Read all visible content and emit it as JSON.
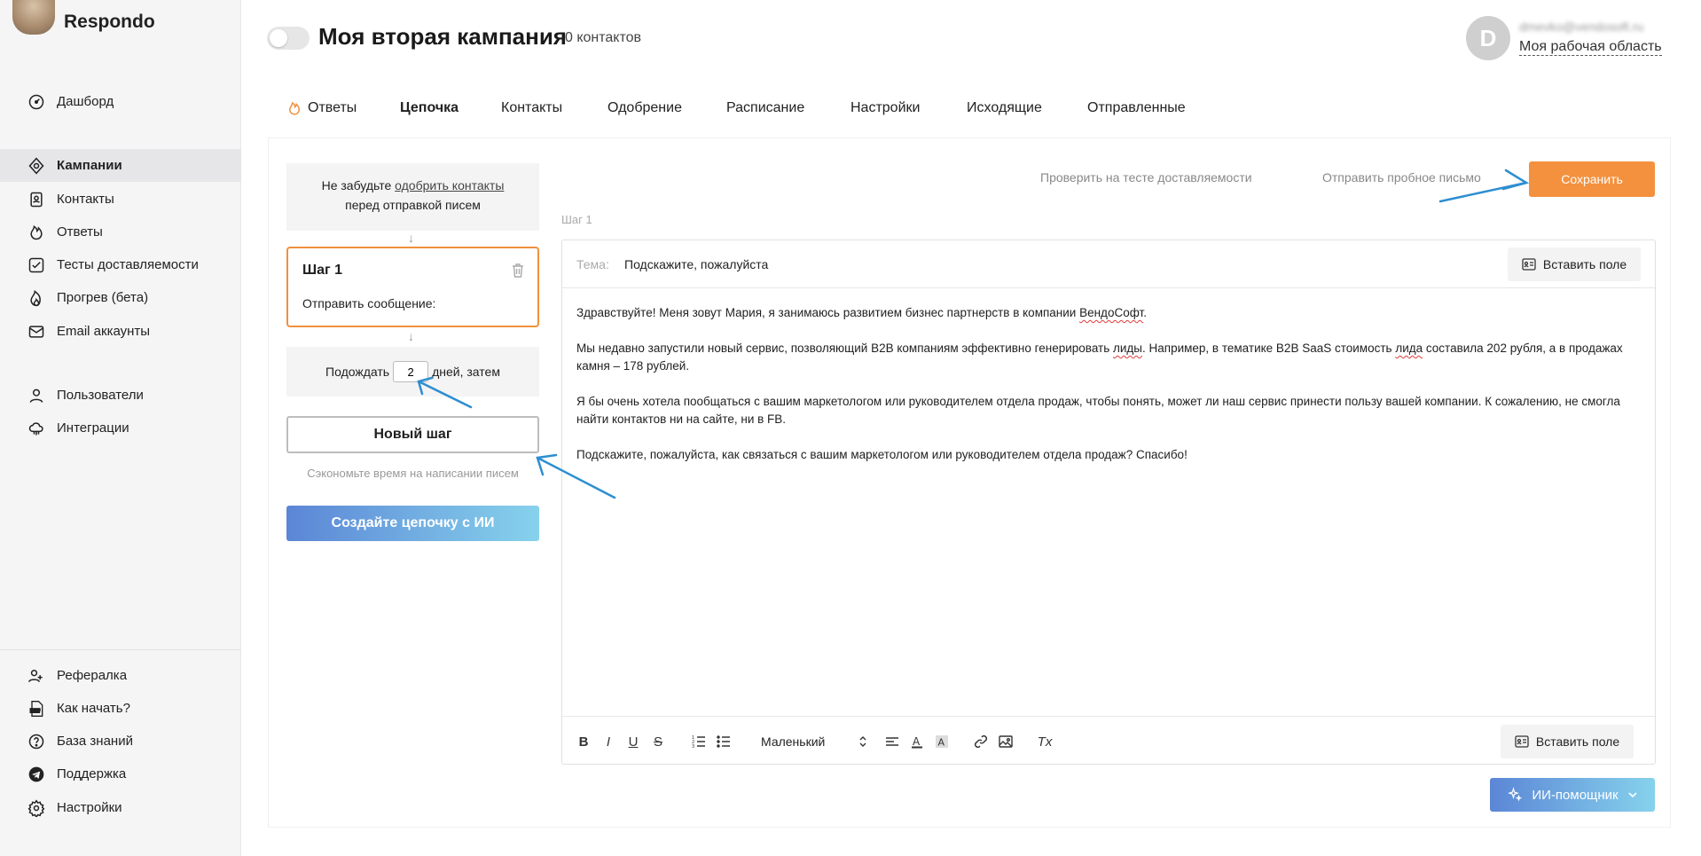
{
  "app": {
    "name": "Respondo"
  },
  "sidebar": {
    "items_top": [
      {
        "label": "Дашборд",
        "icon": "gauge-icon"
      }
    ],
    "items_main": [
      {
        "label": "Кампании",
        "icon": "target-icon",
        "active": true
      },
      {
        "label": "Контакты",
        "icon": "contact-book-icon"
      },
      {
        "label": "Ответы",
        "icon": "flame-icon"
      },
      {
        "label": "Тесты доставляемости",
        "icon": "checkbox-icon"
      },
      {
        "label": "Прогрев (бета)",
        "icon": "fire-icon"
      },
      {
        "label": "Email аккаунты",
        "icon": "mail-icon"
      }
    ],
    "items_admin": [
      {
        "label": "Пользователи",
        "icon": "user-icon"
      },
      {
        "label": "Интеграции",
        "icon": "cloud-icon"
      }
    ],
    "items_bottom": [
      {
        "label": "Рефералка",
        "icon": "users-icon"
      },
      {
        "label": "Как начать?",
        "icon": "pdf-icon"
      },
      {
        "label": "База знаний",
        "icon": "help-icon"
      },
      {
        "label": "Поддержка",
        "icon": "telegram-icon"
      },
      {
        "label": "Настройки",
        "icon": "gear-icon"
      }
    ]
  },
  "header": {
    "campaign_title": "Моя вторая кампания",
    "contacts_count": "0 контактов",
    "avatar_letter": "D",
    "user_email": "dmevko@vendosoft.ru",
    "workspace_link": "Моя рабочая область"
  },
  "tabs": [
    {
      "label": "Ответы",
      "icon": "flame-icon"
    },
    {
      "label": "Цепочка",
      "active": true
    },
    {
      "label": "Контакты"
    },
    {
      "label": "Одобрение"
    },
    {
      "label": "Расписание"
    },
    {
      "label": "Настройки"
    },
    {
      "label": "Исходящие"
    },
    {
      "label": "Отправленные"
    }
  ],
  "chain": {
    "notice_before": "Не забудьте ",
    "notice_link": "одобрить контакты",
    "notice_after": "перед отправкой писем",
    "arrow": "↓",
    "step_title": "Шаг 1",
    "step_sub": "Отправить сообщение:",
    "wait_before": "Подождать",
    "wait_days": "2",
    "wait_after": "дней, затем",
    "new_step": "Новый шаг",
    "save_time": "Сэкономьте время на написании писем",
    "ai_chain": "Создайте цепочку с ИИ"
  },
  "editor": {
    "check_deliverability": "Проверить на тесте доставляемости",
    "send_test": "Отправить пробное письмо",
    "save": "Сохранить",
    "step_label": "Шаг 1",
    "subject_label": "Тема:",
    "subject_value": "Подскажите, пожалуйста",
    "insert_field": "Вставить поле",
    "body": {
      "p1_a": "Здравствуйте! Меня зовут Мария, я занимаюсь развитием бизнес партнерств в компании ",
      "p1_b": "ВендоСофт",
      "p1_c": ".",
      "p2_a": "Мы недавно запустили новый сервис, позволяющий B2B компаниям эффективно генерировать ",
      "p2_b": "лиды",
      "p2_c": ". Например, в тематике B2B SaaS стоимость ",
      "p2_d": "лида",
      "p2_e": " составила 202 рубля, а в продажах камня – 178 рублей.",
      "p3": "Я бы очень хотела пообщаться с вашим маркетологом или руководителем отдела продаж, чтобы понять, может ли наш сервис принести пользу вашей компании. К сожалению, не смогла найти контактов ни на сайте, ни в FB.",
      "p4": "Подскажите, пожалуйста, как связаться с вашим маркетологом или руководителем отдела продаж? Спасибо!"
    },
    "toolbar": {
      "bold": "B",
      "italic": "I",
      "underline": "U",
      "strike": "S",
      "font_size": "Маленький",
      "clear": "Tx"
    },
    "ai_helper": "ИИ-помощник"
  },
  "colors": {
    "accent_orange": "#f3913f",
    "annotation_blue": "#2d8ed1",
    "gradient_start": "#5b86d6",
    "gradient_end": "#86d2ec"
  }
}
